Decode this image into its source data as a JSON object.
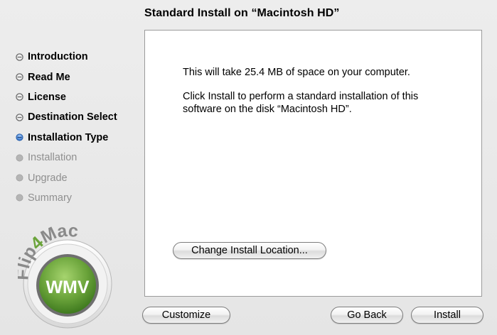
{
  "window": {
    "title": "Standard Install on “Macintosh HD”"
  },
  "sidebar": {
    "steps": [
      {
        "label": "Introduction",
        "state": "done"
      },
      {
        "label": "Read Me",
        "state": "done"
      },
      {
        "label": "License",
        "state": "done"
      },
      {
        "label": "Destination Select",
        "state": "done"
      },
      {
        "label": "Installation Type",
        "state": "current"
      },
      {
        "label": "Installation",
        "state": "future"
      },
      {
        "label": "Upgrade",
        "state": "future"
      },
      {
        "label": "Summary",
        "state": "future"
      }
    ]
  },
  "content": {
    "space_message": "This will take 25.4 MB of space on your computer.",
    "install_message": "Click Install to perform a standard installation of this software on the disk “Macintosh HD”."
  },
  "buttons": {
    "change_location": "Change Install Location...",
    "customize": "Customize",
    "go_back": "Go Back",
    "install": "Install"
  },
  "logo": {
    "brand": "Flip4Mac",
    "product": "WMV"
  },
  "colors": {
    "current_step": "#3b7fd4",
    "done_step": "#6b6b6b",
    "future_step": "#a0a0a0",
    "logo_green": "#6aa33a",
    "logo_gray": "#8a8a8a"
  }
}
